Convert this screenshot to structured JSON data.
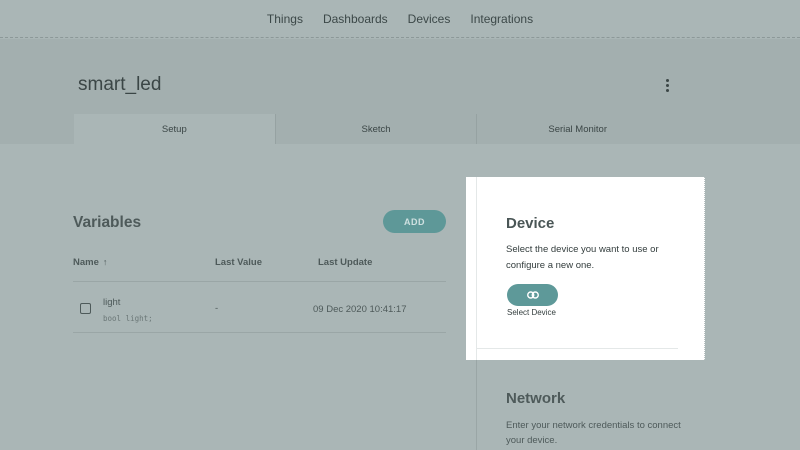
{
  "nav": {
    "items": [
      "Things",
      "Dashboards",
      "Devices",
      "Integrations"
    ]
  },
  "thing": {
    "title": "smart_led",
    "more_icon": "more-vertical-icon"
  },
  "tabs": [
    "Setup",
    "Sketch",
    "Serial Monitor"
  ],
  "active_tab": "Setup",
  "variables": {
    "title": "Variables",
    "add_label": "ADD",
    "columns": {
      "name": "Name",
      "sort_indicator": "↑",
      "last_value": "Last Value",
      "last_update": "Last Update"
    },
    "rows": [
      {
        "name": "light",
        "declaration": "bool light;",
        "last_value": "-",
        "last_update": "09 Dec 2020 10:41:17",
        "checked": false
      }
    ]
  },
  "device": {
    "title": "Device",
    "description": "Select the device you want to use or configure a new one.",
    "button_icon": "link-icon",
    "button_label": "Select Device"
  },
  "network": {
    "title": "Network",
    "description": "Enter your network credentials to connect your device."
  },
  "colors": {
    "overlay_bg": "#aab6b6",
    "accent": "#5e9898",
    "card_bg": "#ffffff"
  }
}
